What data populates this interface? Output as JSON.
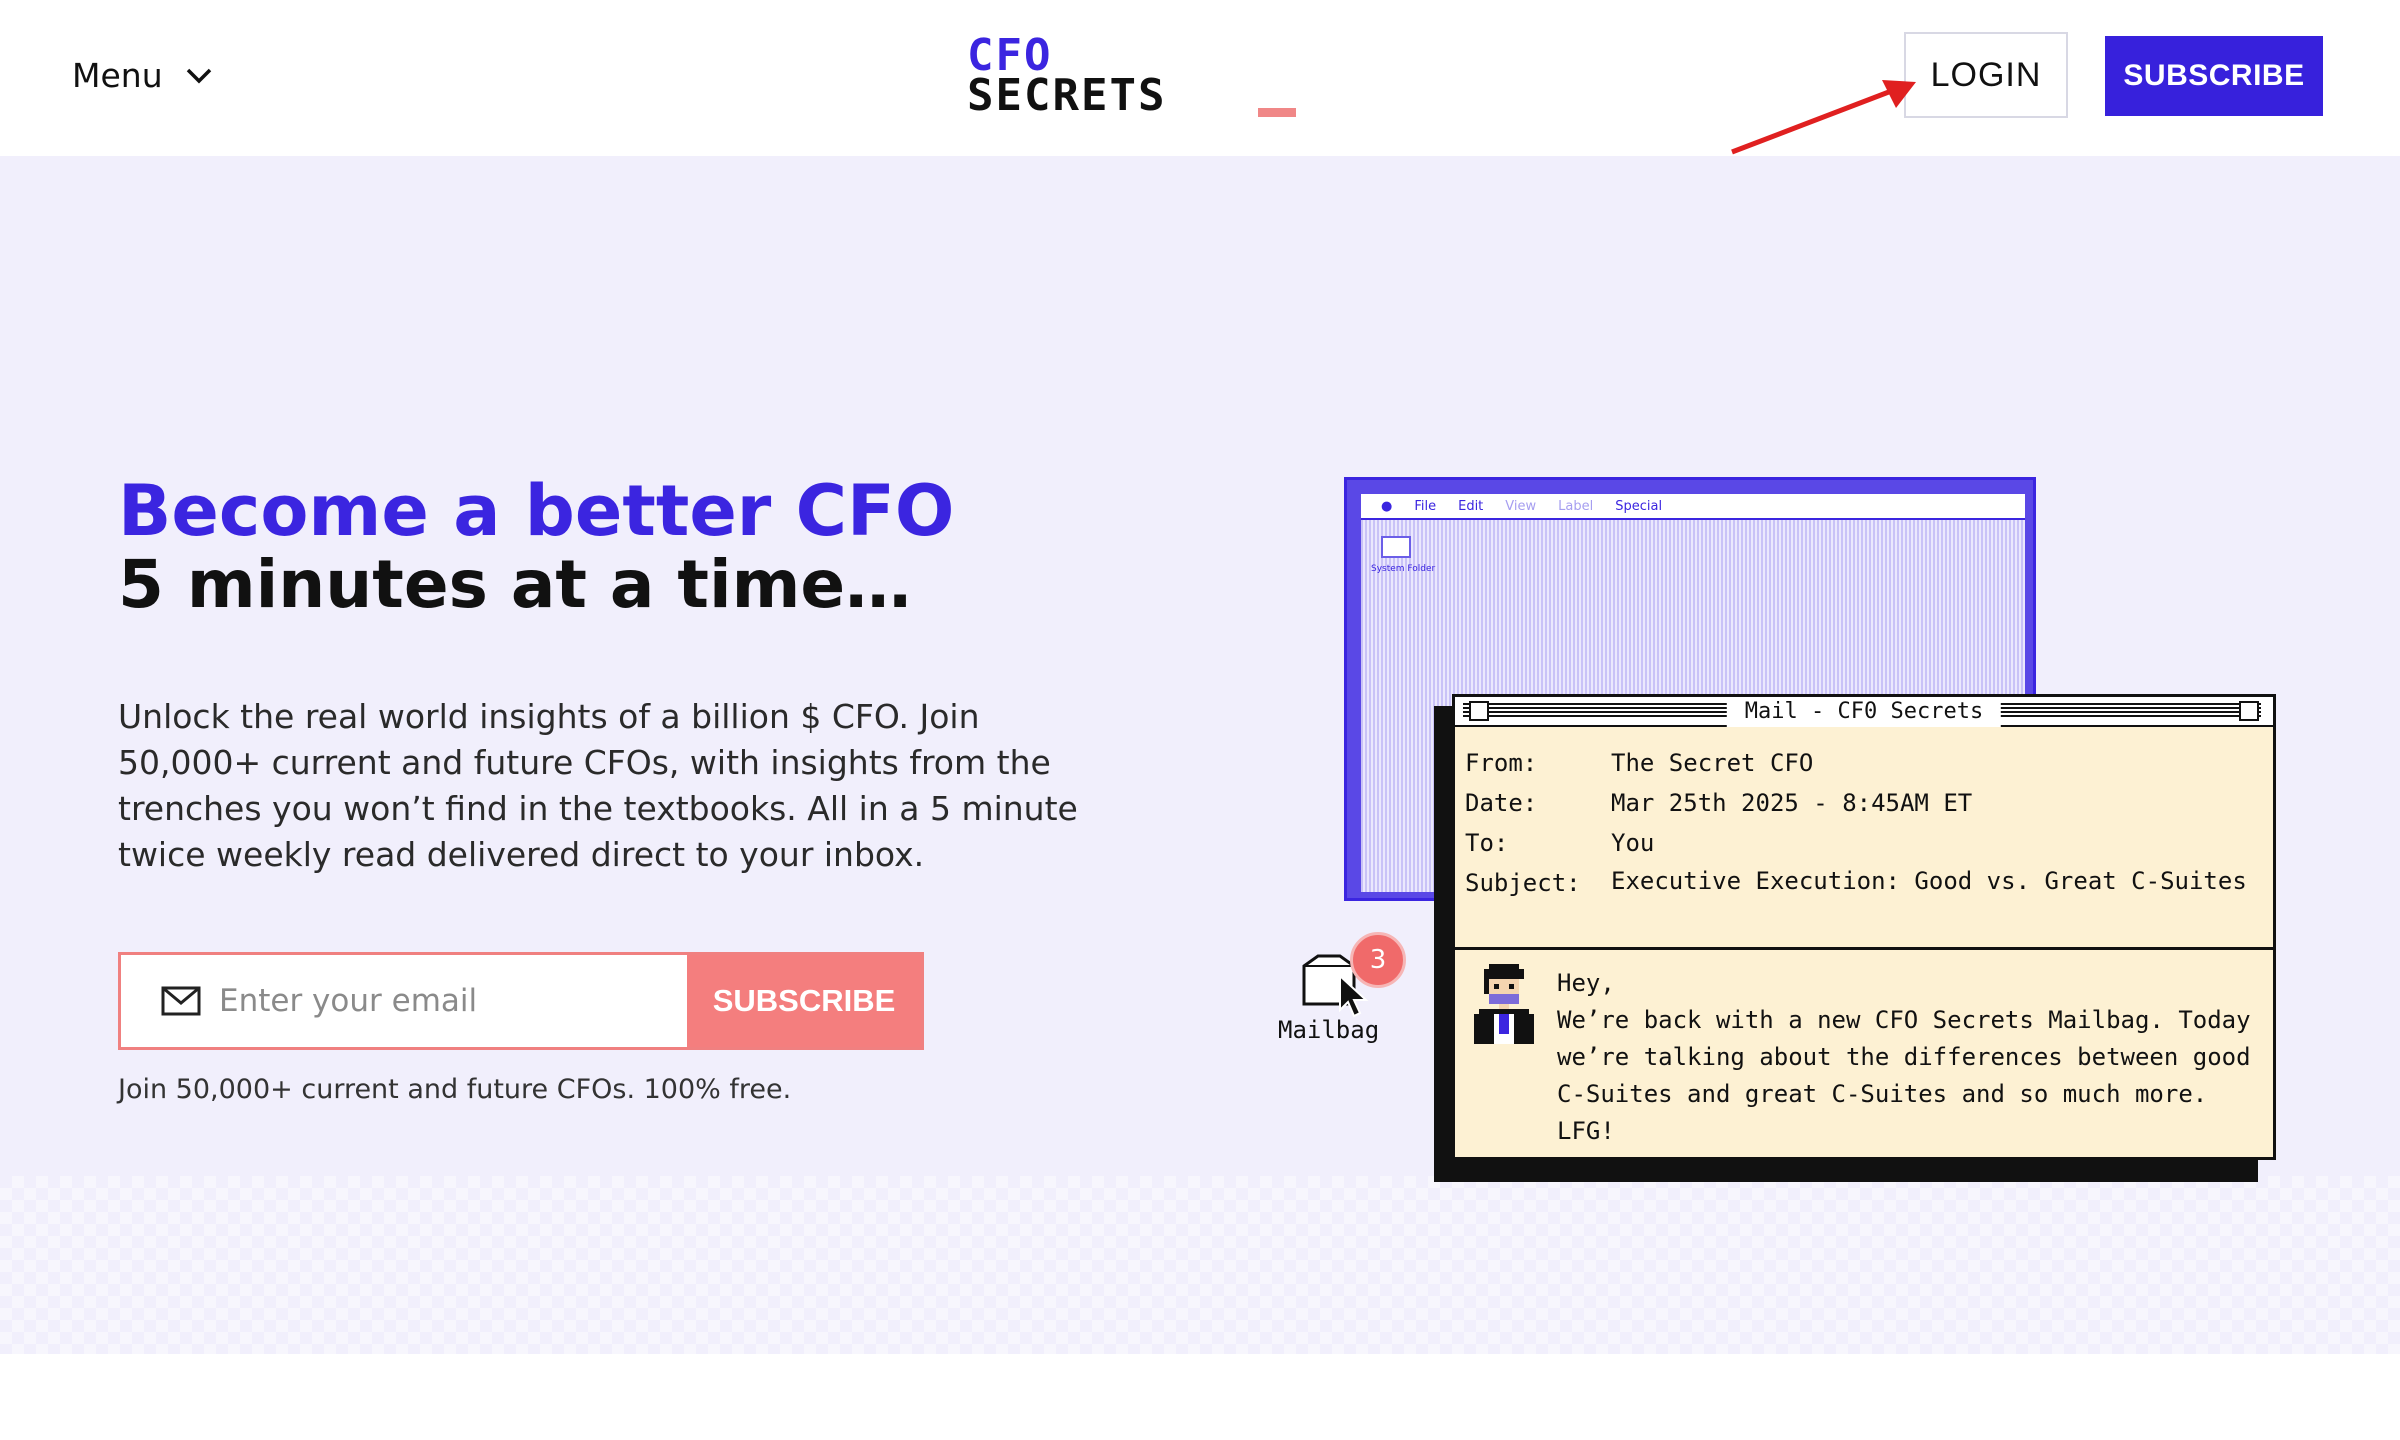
{
  "header": {
    "menu_label": "Menu",
    "logo_line1": "CFO",
    "logo_line2": "SECRETS",
    "login_label": "LOGIN",
    "subscribe_label": "SUBSCRIBE"
  },
  "hero": {
    "title_line1": "Become a better CFO",
    "title_line2": "5 minutes at a time…",
    "description": "Unlock the real world insights of a billion $ CFO. Join 50,000+ current and future CFOs, with insights from the trenches you won’t find in the textbooks. All in a 5 minute twice weekly read delivered direct to your inbox.",
    "email_placeholder": "Enter your email",
    "email_value": "",
    "email_subscribe_label": "SUBSCRIBE",
    "note": "Join 50,000+ current and future CFOs. 100% free."
  },
  "illustration": {
    "back_window_menu": [
      "File",
      "Edit",
      "View",
      "Label",
      "Special"
    ],
    "back_window_folder_label": "System Folder",
    "mail_window_title": "Mail - CF0 Secrets",
    "fields": [
      {
        "key": "From:",
        "value": "The Secret CFO"
      },
      {
        "key": "Date:",
        "value": "Mar 25th 2025 - 8:45AM ET"
      },
      {
        "key": "To:",
        "value": "You"
      },
      {
        "key": "Subject:",
        "value": "Executive Execution: Good vs. Great C-Suites"
      }
    ],
    "body_greeting": "Hey,",
    "body_text": "We’re back with a new CFO Secrets Mailbag. Today we’re talking about the differences between good C-Suites and great C-Suites and so much more. LFG!",
    "mailbag_label": "Mailbag",
    "mailbag_badge": "3"
  },
  "colors": {
    "brand_purple": "#3b25e0",
    "subscribe_bg": "#3721dc",
    "coral": "#f47e7e",
    "hero_bg": "#f1effc",
    "mail_bg": "#fdf1d3",
    "annotation_arrow": "#e02020"
  },
  "icons": {
    "menu_chevron": "chevron-down-icon",
    "email": "mail-icon",
    "annotation": "red-arrow-icon"
  }
}
